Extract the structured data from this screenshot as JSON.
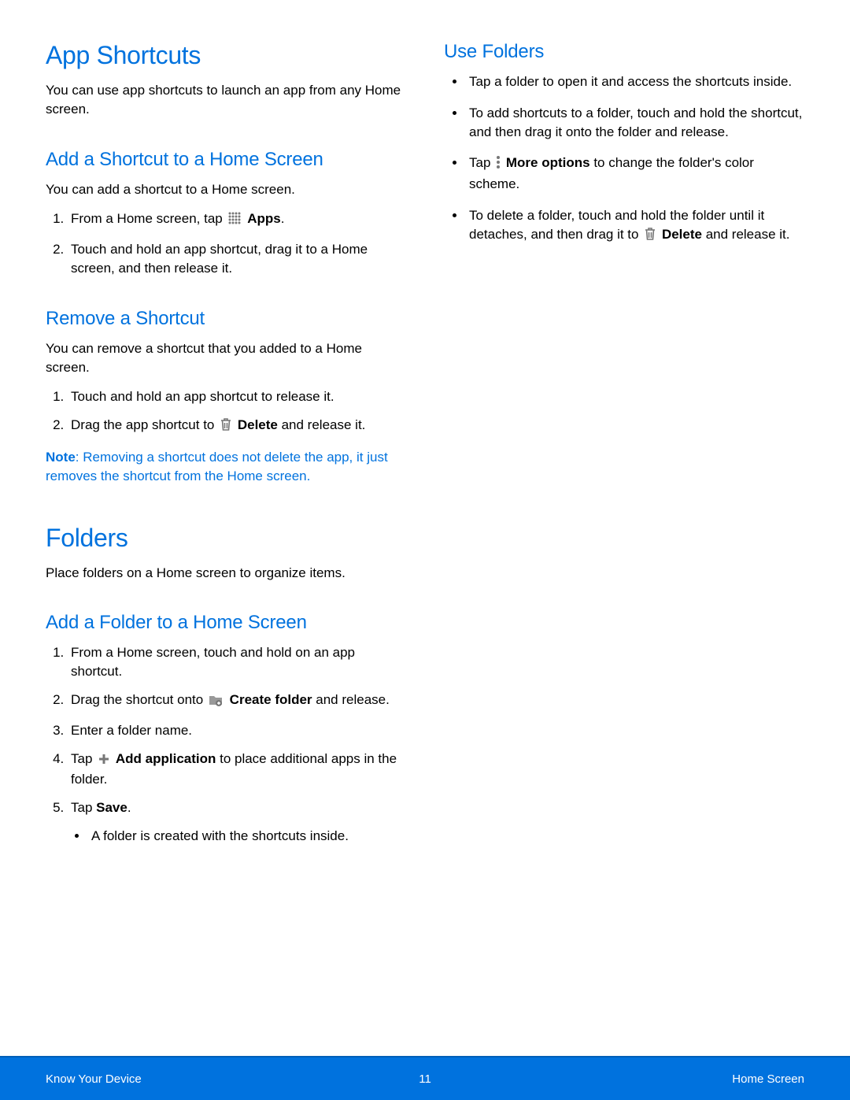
{
  "left": {
    "h1_shortcuts": "App Shortcuts",
    "p_shortcuts_intro": "You can use app shortcuts to launch an app from any Home screen.",
    "h2_add_shortcut": "Add a Shortcut to a Home Screen",
    "p_add_shortcut_intro": "You can add a shortcut to a Home screen.",
    "add_shortcut_1a": "From a Home screen, tap ",
    "add_shortcut_1b": "Apps",
    "add_shortcut_1c": ".",
    "add_shortcut_2": "Touch and hold an app shortcut, drag it to a Home screen, and then release it.",
    "h2_remove": "Remove a Shortcut",
    "p_remove_intro": "You can remove a shortcut that you added to a Home screen.",
    "remove_1": "Touch and hold an app shortcut to release it.",
    "remove_2a": "Drag the app shortcut to ",
    "remove_2b": "Delete",
    "remove_2c": " and release it.",
    "note_label": "Note",
    "note_text": ": Removing a shortcut does not delete the app, it just removes the shortcut from the Home screen.",
    "h1_folders": "Folders",
    "p_folders_intro": "Place folders on a Home screen to organize items.",
    "h2_add_folder": "Add a Folder to a Home Screen",
    "add_folder_1": "From a Home screen, touch and hold on an app shortcut.",
    "add_folder_2a": "Drag the shortcut onto ",
    "add_folder_2b": "Create folder",
    "add_folder_2c": " and release.",
    "add_folder_3": "Enter a folder name.",
    "add_folder_4a": "Tap ",
    "add_folder_4b": "Add application",
    "add_folder_4c": " to place additional apps in the folder.",
    "add_folder_5a": "Tap ",
    "add_folder_5b": "Save",
    "add_folder_5c": ".",
    "add_folder_sub": "A folder is created with the shortcuts inside."
  },
  "right": {
    "h2_use_folders": "Use Folders",
    "uf_1": "Tap a folder to open it and access the shortcuts inside.",
    "uf_2": "To add shortcuts to a folder, touch and hold the shortcut, and then drag it onto the folder and release.",
    "uf_3a": "Tap ",
    "uf_3b": "More options",
    "uf_3c": " to change the folder's color scheme.",
    "uf_4a": "To delete a folder, touch and hold the folder until it detaches, and then drag it to ",
    "uf_4b": "Delete",
    "uf_4c": " and release it."
  },
  "footer": {
    "left": "Know Your Device",
    "page": "11",
    "right": "Home Screen"
  }
}
